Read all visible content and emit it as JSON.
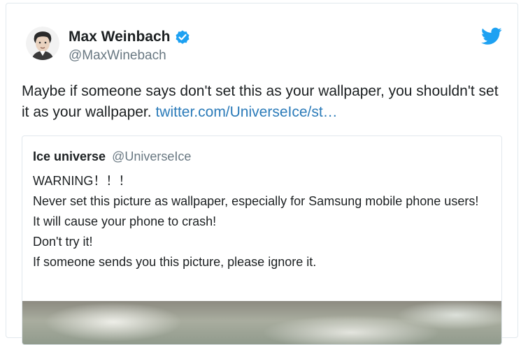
{
  "author": {
    "name": "Max Weinbach",
    "handle": "@MaxWinebach",
    "verified": true,
    "avatar_icon": "user-avatar"
  },
  "brand": {
    "icon": "twitter-bird-icon",
    "color": "#1da1f2"
  },
  "tweet": {
    "text": "Maybe if someone says don't set this as your wallpaper, you shouldn't set it as your wallpaper.",
    "link": "twitter.com/UniverseIce/st…"
  },
  "quoted_tweet": {
    "name": "Ice universe",
    "handle": "@UniverseIce",
    "lines": [
      "WARNING！！！",
      "Never set this picture as wallpaper, especially for Samsung mobile phone users!",
      "It will cause your phone to crash!",
      "Don't try it!",
      "If someone sends you this picture, please ignore it."
    ]
  },
  "colors": {
    "link": "#2b7bb9",
    "secondary_text": "#697882",
    "border": "#e1e8ed"
  }
}
